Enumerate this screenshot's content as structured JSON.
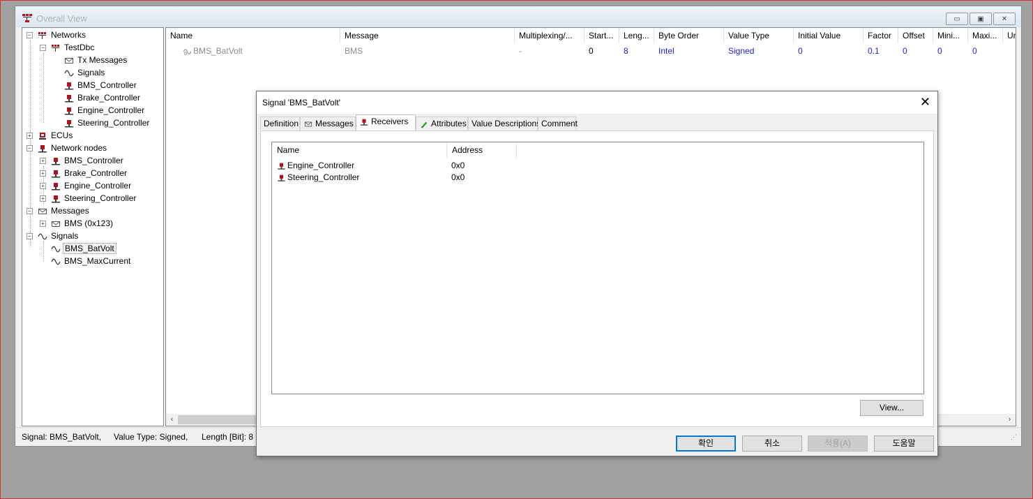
{
  "window": {
    "title": "Overall View",
    "btn_min": "▭",
    "btn_max": "▣",
    "btn_close": "✕"
  },
  "tree": {
    "networks": "Networks",
    "testdbc": "TestDbc",
    "tx_messages": "Tx Messages",
    "signals_sub": "Signals",
    "net_bms": "BMS_Controller",
    "net_brake": "Brake_Controller",
    "net_engine": "Engine_Controller",
    "net_steering": "Steering_Controller",
    "ecus": "ECUs",
    "network_nodes": "Network nodes",
    "node_bms": "BMS_Controller",
    "node_brake": "Brake_Controller",
    "node_engine": "Engine_Controller",
    "node_steering": "Steering_Controller",
    "messages": "Messages",
    "msg_bms": "BMS (0x123)",
    "signals": "Signals",
    "sig_batvolt": "BMS_BatVolt",
    "sig_maxcurrent": "BMS_MaxCurrent"
  },
  "grid": {
    "headers": [
      "Name",
      "Message",
      "Multiplexing/...",
      "Start...",
      "Leng...",
      "Byte Order",
      "Value Type",
      "Initial Value",
      "Factor",
      "Offset",
      "Mini...",
      "Maxi...",
      "Ur"
    ],
    "row": [
      "BMS_BatVolt",
      "BMS",
      "-",
      "0",
      "8",
      "Intel",
      "Signed",
      "0",
      "0.1",
      "0",
      "0",
      "0"
    ]
  },
  "status": {
    "signal": "Signal: BMS_BatVolt,",
    "value_type": "Value Type: Signed,",
    "length": "Length [Bit]: 8"
  },
  "dialog": {
    "title": "Signal 'BMS_BatVolt'",
    "close": "✕",
    "tabs": [
      "Definition",
      "Messages",
      "Receivers",
      "Attributes",
      "Value Descriptions",
      "Comment"
    ],
    "list_headers": [
      "Name",
      "Address"
    ],
    "receivers": [
      {
        "name": "Engine_Controller",
        "address": "0x0"
      },
      {
        "name": "Steering_Controller",
        "address": "0x0"
      }
    ],
    "view_button": "View...",
    "ok": "확인",
    "cancel": "취소",
    "apply": "적용(A)",
    "help": "도움말"
  }
}
